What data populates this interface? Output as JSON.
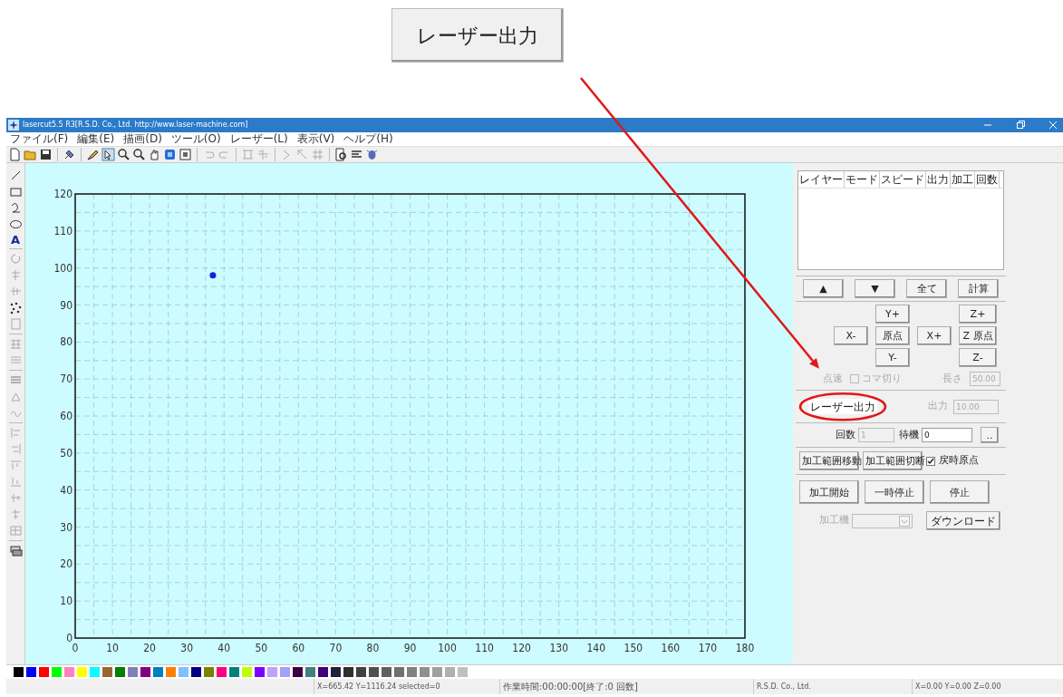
{
  "callout": {
    "button": "レーザー出力"
  },
  "window": {
    "title": "lasercut5.5 R3[R.S.D. Co., Ltd. http://www.laser-machine.com]"
  },
  "menu": [
    "ファイル(F)",
    "編集(E)",
    "描画(D)",
    "ツール(O)",
    "レーザー(L)",
    "表示(V)",
    "ヘルプ(H)"
  ],
  "left_toolbar": {
    "text_tool": "A"
  },
  "canvas": {
    "chart_data": {
      "type": "scatter",
      "grid": true,
      "x": [
        37
      ],
      "series": [
        {
          "color": "#1020e0",
          "values": [
            98
          ]
        }
      ],
      "xlim": [
        0,
        180
      ],
      "ylim": [
        0,
        120
      ],
      "xticks": [
        0,
        10,
        20,
        30,
        40,
        50,
        60,
        70,
        80,
        90,
        100,
        110,
        120,
        130,
        140,
        150,
        160,
        170,
        180
      ],
      "yticks": [
        0,
        10,
        20,
        30,
        40,
        50,
        60,
        70,
        80,
        90,
        100,
        110,
        120
      ]
    }
  },
  "layer_table": {
    "columns": [
      "レイヤー",
      "モード",
      "スピード",
      "出力",
      "加工",
      "回数"
    ]
  },
  "order_buttons": [
    "▲",
    "▼",
    "全て",
    "計算"
  ],
  "jog": {
    "y_plus": "Y+",
    "z_plus": "Z+",
    "x_minus": "X-",
    "origin": "原点",
    "x_plus": "X+",
    "z_origin": "Z 原点",
    "y_minus": "Y-",
    "z_minus": "Z-"
  },
  "speed_row": {
    "point_speed": {
      "label": "点速",
      "disabled": true
    },
    "frame_cut": {
      "label": "コマ切り",
      "checked": false,
      "disabled": true
    },
    "length": {
      "label": "長さ",
      "value": "50.00",
      "disabled": true
    }
  },
  "laser_row": {
    "button": "レーザー出力",
    "power": {
      "label": "出力",
      "value": "10.00",
      "disabled": true
    }
  },
  "repeat_row": {
    "count": {
      "label": "回数",
      "value": "1",
      "disabled": true
    },
    "wait": {
      "label": "待機",
      "value": "0",
      "disabled": false
    },
    "browse_button": ".."
  },
  "range_row": {
    "move": "加工範囲移動",
    "cut": "加工範囲切断",
    "return_origin": {
      "label": "戻時原点",
      "checked": true
    }
  },
  "run_row": [
    "加工開始",
    "一時停止",
    "停止"
  ],
  "machine_row": {
    "label": "加工機",
    "disabled": true,
    "download": "ダウンロード"
  },
  "palette": [
    {
      "color": "#000000"
    },
    {
      "color": "#0000ff"
    },
    {
      "color": "#ff0000"
    },
    {
      "color": "#00ff00"
    },
    {
      "color": "#ff80c0"
    },
    {
      "color": "#ffff00"
    },
    {
      "color": "#00ffff"
    },
    {
      "color": "#996633"
    },
    {
      "color": "#008000"
    },
    {
      "color": "#8080c0"
    },
    {
      "color": "#800080"
    },
    {
      "color": "#0080c0"
    },
    {
      "color": "#ff8000"
    },
    {
      "color": "#80c0ff"
    },
    {
      "color": "#000080"
    },
    {
      "color": "#808000"
    },
    {
      "color": "#ff0080"
    },
    {
      "color": "#008080"
    },
    {
      "color": "#c0ff00"
    },
    {
      "color": "#8000ff"
    },
    {
      "color": "#c0a0ff"
    },
    {
      "color": "#a0a0ff"
    },
    {
      "color": "#400040"
    },
    {
      "color": "#408080"
    },
    {
      "color": "#400080"
    },
    {
      "color": "#202040"
    },
    {
      "color": "#303030"
    },
    {
      "color": "#404040"
    },
    {
      "color": "#505050"
    },
    {
      "color": "#606060"
    },
    {
      "color": "#707070"
    },
    {
      "color": "#808080"
    },
    {
      "color": "#909090"
    },
    {
      "color": "#a0a0a0"
    },
    {
      "color": "#b0b0b0"
    },
    {
      "color": "#c0c0c0"
    }
  ],
  "status_bar": [
    "X=665.42 Y=1116.24 selected=0",
    "作業時間:00:00:00[終了:0 回数]",
    "R.S.D. Co., Ltd.",
    "X=0.00 Y=0.00 Z=0.00"
  ]
}
